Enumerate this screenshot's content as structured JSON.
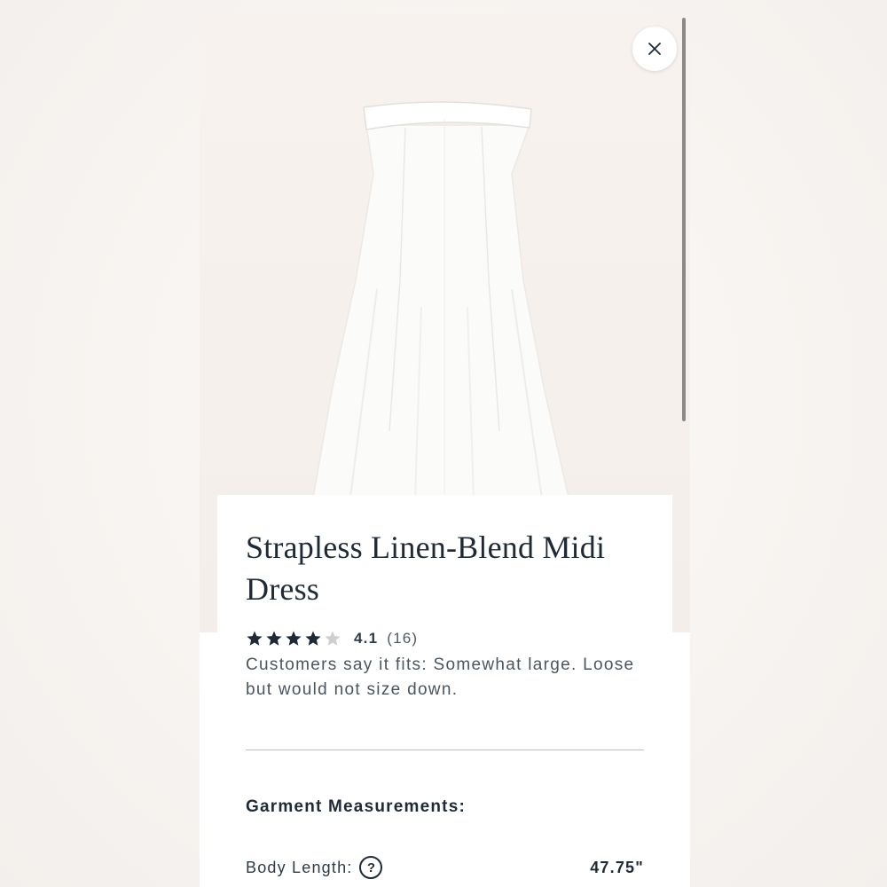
{
  "product": {
    "title": "Strapless Linen-Blend Midi Dress",
    "rating": {
      "value_text": "4.1",
      "count_text": "(16)",
      "stars_filled": 4,
      "stars_total": 5
    },
    "fit_note": "Customers say it fits: Somewhat large. Loose but would not size down."
  },
  "measurements": {
    "heading": "Garment Measurements:",
    "rows": [
      {
        "label": "Body Length:",
        "value": "47.75\""
      }
    ]
  },
  "help_icon_glyph": "?",
  "icons": {
    "close": "close-icon",
    "star": "star-icon",
    "help": "question-circle-icon"
  },
  "colors": {
    "text_primary": "#1f2a37",
    "star_filled": "#1f2a37",
    "star_empty": "#cfcfcf",
    "hero_bg": "#f6f0ec"
  }
}
